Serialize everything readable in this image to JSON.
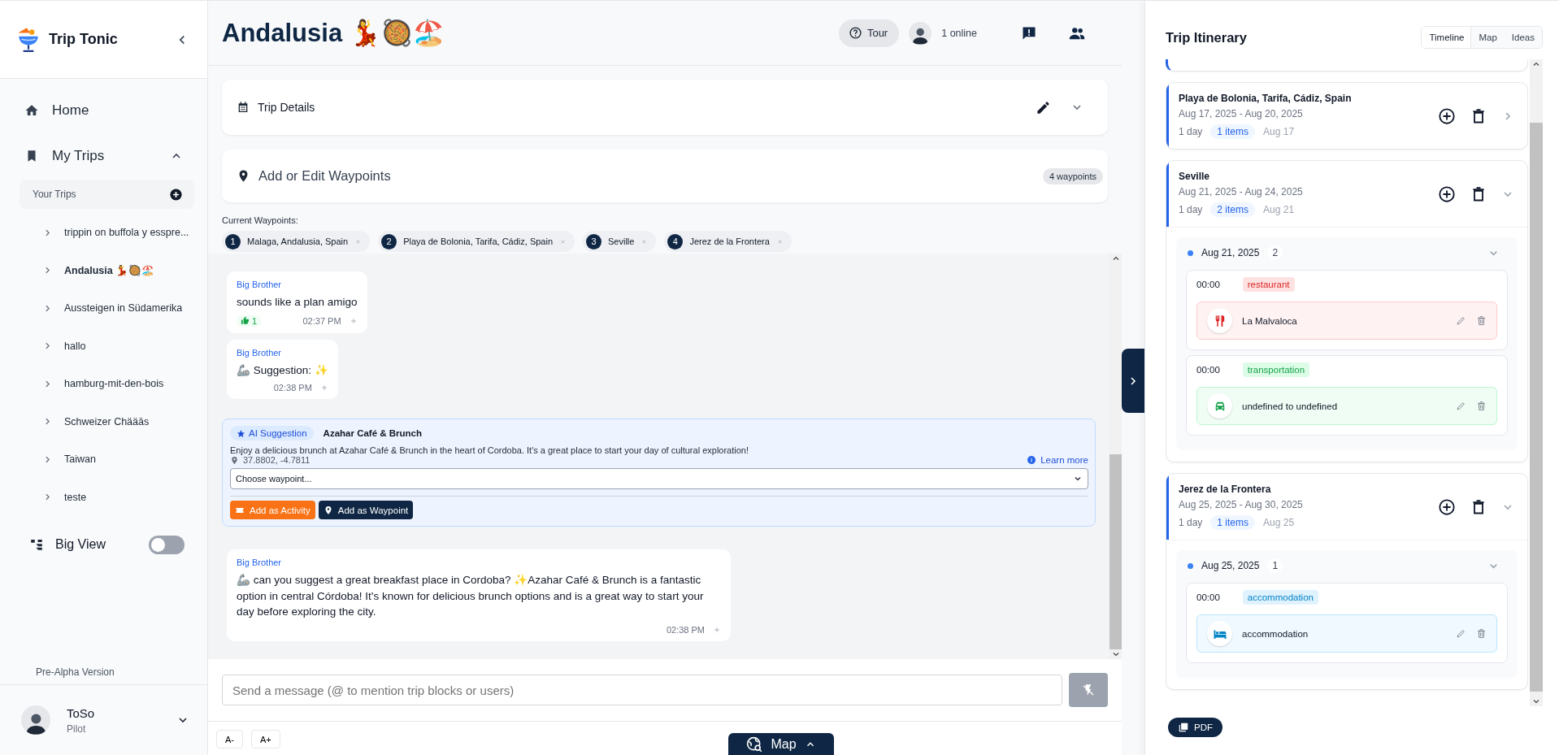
{
  "sidebar": {
    "brand": "Trip Tonic",
    "home": "Home",
    "my_trips": {
      "label": "My Trips",
      "expanded": true
    },
    "your_trips": "Your Trips",
    "trips": [
      {
        "name": "trippin on buffola y esspre...",
        "selected": false
      },
      {
        "name": "Andalusia 💃🥘🏖️",
        "selected": true
      },
      {
        "name": "Aussteigen in Südamerika",
        "selected": false
      },
      {
        "name": "hallo",
        "selected": false
      },
      {
        "name": "hamburg-mit-den-bois",
        "selected": false
      },
      {
        "name": "Schweizer Chääās",
        "selected": false
      },
      {
        "name": "Taiwan",
        "selected": false
      },
      {
        "name": "teste",
        "selected": false
      }
    ],
    "big_view": {
      "label": "Big View",
      "on": false
    },
    "version": "Pre-Alpha Version",
    "user": {
      "name": "ToSo",
      "role": "Pilot"
    }
  },
  "header": {
    "title": "Andalusia 💃🥘🏖️",
    "tour": "Tour",
    "online": "1 online"
  },
  "trip_details": {
    "label": "Trip Details",
    "expanded": false
  },
  "waypoints": {
    "label": "Add or Edit Waypoints",
    "count": "4 waypoints",
    "current_label": "Current Waypoints:",
    "items": [
      {
        "number": "1",
        "name": "Malaga, Andalusia, Spain"
      },
      {
        "number": "2",
        "name": "Playa de Bolonia, Tarifa, Cádiz, Spain"
      },
      {
        "number": "3",
        "name": "Seville"
      },
      {
        "number": "4",
        "name": "Jerez de la Frontera"
      }
    ]
  },
  "messages": [
    {
      "kind": "message",
      "author": "Big Brother",
      "text": "sounds like a plan amigo",
      "reaction": "1",
      "time": "02:37 PM"
    },
    {
      "kind": "message",
      "author": "Big Brother",
      "text": "🦾 Suggestion: ✨",
      "time": "02:38 PM"
    },
    {
      "kind": "suggestion",
      "badge": "AI Suggestion",
      "title": "Azahar Café & Brunch",
      "text": "Enjoy a delicious brunch at Azahar Café & Brunch in the heart of Cordoba. It's a great place to start your day of cultural exploration!",
      "coords": "37.8802, -4.7811",
      "learn_more": "Learn more",
      "select": "Choose waypoint...",
      "activity_button": "Add as Activity",
      "waypoint_button": "Add as Waypoint"
    },
    {
      "kind": "message",
      "author": "Big Brother",
      "text": "🦾 can you suggest a great breakfast place in Cordoba? ✨Azahar Café & Brunch is a fantastic option in central Córdoba! It's known for delicious brunch options and is a great way to start your day before exploring the city.",
      "time": "02:38 PM"
    }
  ],
  "composer": {
    "placeholder": "Send a message (@ to mention trip blocks or users)"
  },
  "font_buttons": [
    "A-",
    "A+"
  ],
  "map_button": "Map",
  "itinerary": {
    "title": "Trip Itinerary",
    "tabs": [
      {
        "label": "Timeline",
        "selected": true
      },
      {
        "label": "Map",
        "selected": false
      },
      {
        "label": "Ideas",
        "selected": false
      }
    ],
    "stops": [
      {
        "title": "Playa de Bolonia, Tarifa, Cádiz, Spain",
        "dates": "Aug 17, 2025 - Aug 20, 2025",
        "length": "1 day",
        "items": "1 items",
        "first_day": "Aug 17",
        "expanded": false
      },
      {
        "title": "Seville",
        "dates": "Aug 21, 2025 - Aug 24, 2025",
        "length": "1 day",
        "items": "2 items",
        "first_day": "Aug 21",
        "expanded": true,
        "days": [
          {
            "date": "Aug 21, 2025",
            "count": "2",
            "expanded": true,
            "entries": [
              {
                "time": "00:00",
                "kind": "restaurant",
                "category": "restaurant",
                "name": "La Malvaloca"
              },
              {
                "time": "00:00",
                "kind": "transportation",
                "category": "transportation",
                "name": "undefined to undefined"
              }
            ]
          }
        ]
      },
      {
        "title": "Jerez de la Frontera",
        "dates": "Aug 25, 2025 - Aug 30, 2025",
        "length": "1 day",
        "items": "1 items",
        "first_day": "Aug 25",
        "expanded": true,
        "days": [
          {
            "date": "Aug 25, 2025",
            "count": "1",
            "expanded": true,
            "entries": [
              {
                "time": "00:00",
                "kind": "accommodation",
                "category": "accommodation",
                "name": "accommodation"
              }
            ]
          }
        ]
      }
    ],
    "pdf": "PDF"
  }
}
